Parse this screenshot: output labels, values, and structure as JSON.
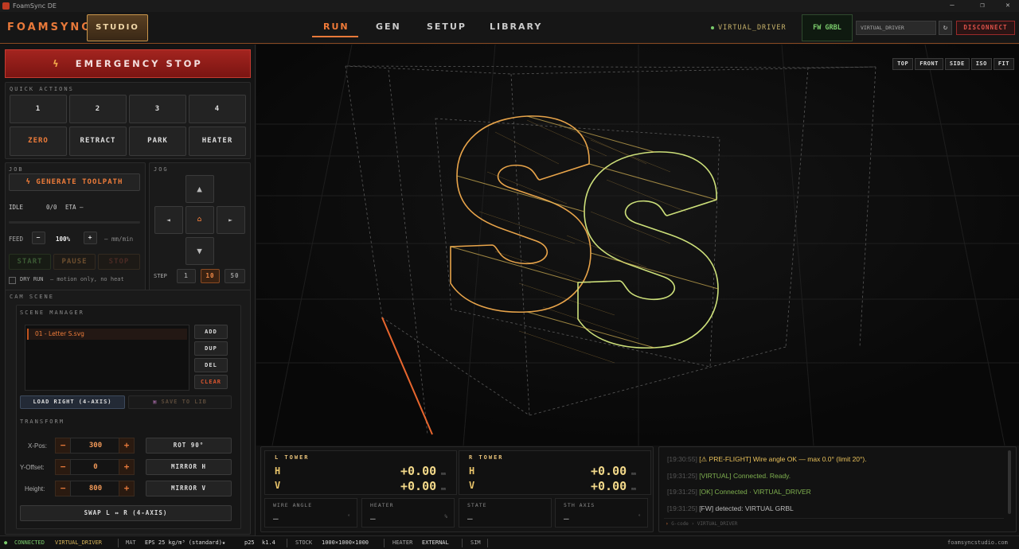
{
  "window": {
    "title": "FoamSync DE",
    "controls": [
      "–",
      "❐",
      "✕"
    ]
  },
  "header": {
    "brand": "FOAMSYNC",
    "studio": "STUDIO",
    "tabs": [
      "RUN",
      "GEN",
      "SETUP",
      "LIBRARY"
    ],
    "active_tab": "RUN",
    "driver_label": "VIRTUAL_DRIVER",
    "fw": "FW GRBL",
    "driver_select": "VIRTUAL_DRIVER",
    "refresh": "↻",
    "disconnect": "DISCONNECT"
  },
  "left": {
    "estop": "EMERGENCY STOP",
    "quick_actions": {
      "label": "QUICK ACTIONS",
      "slots": [
        "1",
        "2",
        "3",
        "4"
      ],
      "actions": [
        "ZERO",
        "RETRACT",
        "PARK",
        "HEATER"
      ]
    },
    "job": {
      "label": "JOB",
      "generate": "GENERATE TOOLPATH",
      "state": "IDLE",
      "progress": "0/0",
      "eta": "ETA —",
      "progress_fraction": 0,
      "feed_label": "FEED",
      "feed_minus": "−",
      "feed_value": "100%",
      "feed_plus": "+",
      "feed_units": "— mm/min",
      "start": "START",
      "pause": "PAUSE",
      "stop": "STOP",
      "dry_run": "DRY RUN",
      "dry_run_note": "— motion only, no heat"
    },
    "jog": {
      "label": "JOG",
      "up": "▲",
      "down": "▼",
      "left": "◄",
      "right": "►",
      "home": "⌂",
      "step_label": "STEP",
      "steps": [
        "1",
        "10",
        "50"
      ],
      "active_step": "10"
    },
    "cam": {
      "label": "CAM SCENE",
      "scene_manager": "SCENE MANAGER",
      "items": [
        "01 - Letter S.svg"
      ],
      "add": "ADD",
      "dup": "DUP",
      "del": "DEL",
      "clear": "CLEAR",
      "load_right": "LOAD RIGHT (4-AXIS)",
      "save_to_lib": "SAVE TO LIB",
      "transform": "TRANSFORM",
      "xpos_label": "X-Pos:",
      "xpos": "300",
      "yoff_label": "Y-Offset:",
      "yoff": "0",
      "height_label": "Height:",
      "height": "800",
      "minus": "−",
      "plus": "+",
      "rot90": "ROT 90°",
      "mirror_h": "MIRROR H",
      "mirror_v": "MIRROR V",
      "swap": "SWAP L ↔ R (4-AXIS)"
    }
  },
  "viewport": {
    "views": [
      "TOP",
      "FRONT",
      "SIDE",
      "ISO",
      "FIT"
    ]
  },
  "towers": {
    "left": {
      "title": "L TOWER",
      "h_label": "H",
      "h": "+0.00",
      "v_label": "V",
      "v": "+0.00",
      "unit": "mm"
    },
    "right": {
      "title": "R TOWER",
      "h_label": "H",
      "h": "+0.00",
      "v_label": "V",
      "v": "+0.00",
      "unit": "mm"
    },
    "stats": [
      {
        "label": "WIRE ANGLE",
        "value": "—",
        "unit": "°"
      },
      {
        "label": "HEATER",
        "value": "—",
        "unit": "%"
      },
      {
        "label": "STATE",
        "value": "—",
        "unit": ""
      },
      {
        "label": "5TH AXIS",
        "value": "—",
        "unit": "°"
      }
    ]
  },
  "console": {
    "lines": [
      {
        "ts": "[19:30:55]",
        "text": "[⚠ PRE-FLIGHT] Wire angle OK — max 0.0° (limit 20°).",
        "color": "#e8c05a"
      },
      {
        "ts": "[19:31:25]",
        "text": "[VIRTUAL] Connected. Ready.",
        "color": "#7fb04f"
      },
      {
        "ts": "[19:31:25]",
        "text": "[OK] Connected · VIRTUAL_DRIVER",
        "color": "#7fb04f"
      },
      {
        "ts": "[19:31:25]",
        "text": "[FW] detected: VIRTUAL GRBL",
        "color": "#bbbbbb"
      }
    ],
    "cmd_prompt": "›",
    "cmd_placeholder": "G-code › VIRTUAL_DRIVER"
  },
  "statusbar": {
    "connected": "CONNECTED",
    "driver": "VIRTUAL_DRIVER",
    "mat_label": "MAT",
    "mat": "EPS 25 kg/m³ (standard)★",
    "p": "p25",
    "k": "k1.4",
    "stock_label": "STOCK",
    "stock": "1000×1000×1000",
    "heater_label": "HEATER",
    "heater": "EXTERNAL",
    "sim": "SIM",
    "site": "foamsyncstudio.com"
  },
  "colors": {
    "accent": "#e8793a",
    "estop": "#a3241f",
    "ok": "#7acb6b",
    "warn": "#e8c05a"
  }
}
